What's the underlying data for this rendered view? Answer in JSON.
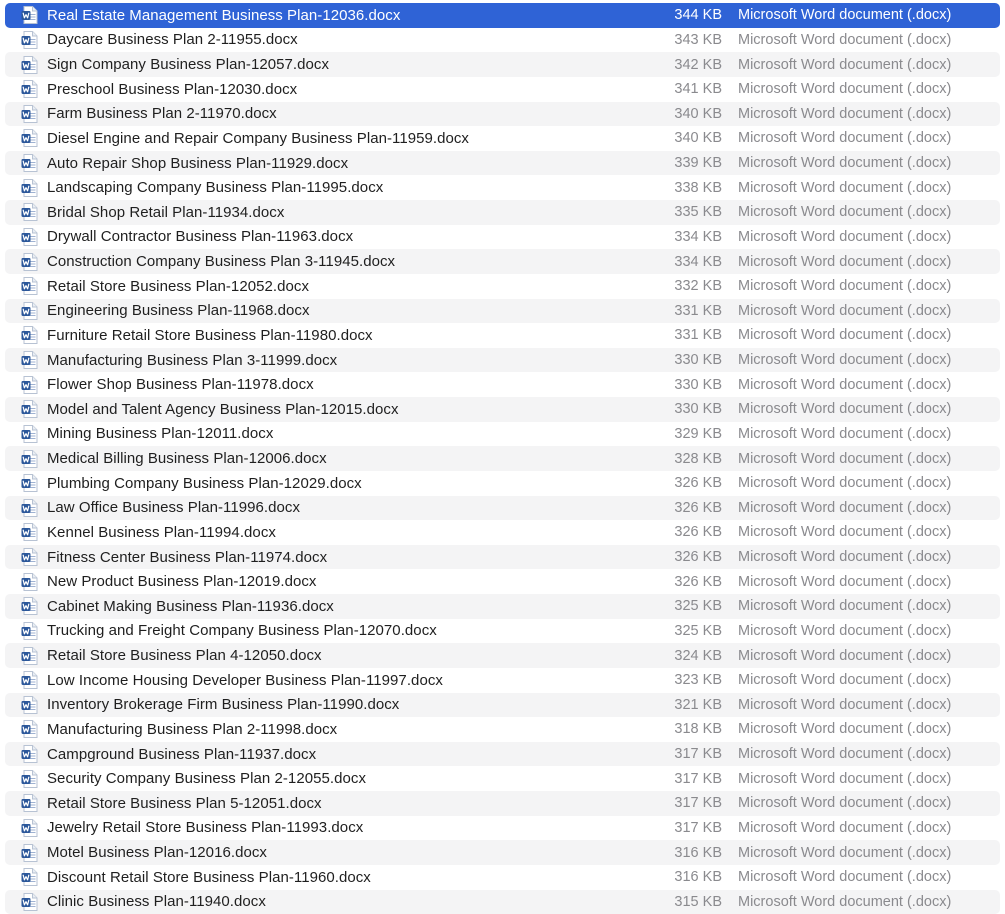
{
  "colors": {
    "selection": "#2f63d6",
    "stripe": "#f4f4f5",
    "word_blue": "#2b579a",
    "secondary_text": "#8a8a8e"
  },
  "icon_name": "word-document-icon",
  "selected_index": 0,
  "files": [
    {
      "name": "Real Estate Management Business Plan-12036.docx",
      "size": "344 KB",
      "kind": "Microsoft Word document (.docx)"
    },
    {
      "name": "Daycare Business Plan 2-11955.docx",
      "size": "343 KB",
      "kind": "Microsoft Word document (.docx)"
    },
    {
      "name": "Sign Company Business Plan-12057.docx",
      "size": "342 KB",
      "kind": "Microsoft Word document (.docx)"
    },
    {
      "name": "Preschool Business Plan-12030.docx",
      "size": "341 KB",
      "kind": "Microsoft Word document (.docx)"
    },
    {
      "name": "Farm Business Plan 2-11970.docx",
      "size": "340 KB",
      "kind": "Microsoft Word document (.docx)"
    },
    {
      "name": "Diesel Engine and Repair Company Business Plan-11959.docx",
      "size": "340 KB",
      "kind": "Microsoft Word document (.docx)"
    },
    {
      "name": "Auto Repair Shop Business Plan-11929.docx",
      "size": "339 KB",
      "kind": "Microsoft Word document (.docx)"
    },
    {
      "name": "Landscaping Company Business Plan-11995.docx",
      "size": "338 KB",
      "kind": "Microsoft Word document (.docx)"
    },
    {
      "name": "Bridal Shop Retail Plan-11934.docx",
      "size": "335 KB",
      "kind": "Microsoft Word document (.docx)"
    },
    {
      "name": "Drywall Contractor Business Plan-11963.docx",
      "size": "334 KB",
      "kind": "Microsoft Word document (.docx)"
    },
    {
      "name": "Construction Company Business Plan 3-11945.docx",
      "size": "334 KB",
      "kind": "Microsoft Word document (.docx)"
    },
    {
      "name": "Retail Store Business Plan-12052.docx",
      "size": "332 KB",
      "kind": "Microsoft Word document (.docx)"
    },
    {
      "name": "Engineering Business Plan-11968.docx",
      "size": "331 KB",
      "kind": "Microsoft Word document (.docx)"
    },
    {
      "name": "Furniture Retail Store Business Plan-11980.docx",
      "size": "331 KB",
      "kind": "Microsoft Word document (.docx)"
    },
    {
      "name": "Manufacturing Business Plan 3-11999.docx",
      "size": "330 KB",
      "kind": "Microsoft Word document (.docx)"
    },
    {
      "name": "Flower Shop Business Plan-11978.docx",
      "size": "330 KB",
      "kind": "Microsoft Word document (.docx)"
    },
    {
      "name": "Model and Talent Agency Business Plan-12015.docx",
      "size": "330 KB",
      "kind": "Microsoft Word document (.docx)"
    },
    {
      "name": "Mining Business Plan-12011.docx",
      "size": "329 KB",
      "kind": "Microsoft Word document (.docx)"
    },
    {
      "name": "Medical Billing Business Plan-12006.docx",
      "size": "328 KB",
      "kind": "Microsoft Word document (.docx)"
    },
    {
      "name": "Plumbing Company Business Plan-12029.docx",
      "size": "326 KB",
      "kind": "Microsoft Word document (.docx)"
    },
    {
      "name": "Law Office Business Plan-11996.docx",
      "size": "326 KB",
      "kind": "Microsoft Word document (.docx)"
    },
    {
      "name": "Kennel Business Plan-11994.docx",
      "size": "326 KB",
      "kind": "Microsoft Word document (.docx)"
    },
    {
      "name": "Fitness Center Business Plan-11974.docx",
      "size": "326 KB",
      "kind": "Microsoft Word document (.docx)"
    },
    {
      "name": "New Product Business Plan-12019.docx",
      "size": "326 KB",
      "kind": "Microsoft Word document (.docx)"
    },
    {
      "name": "Cabinet Making Business Plan-11936.docx",
      "size": "325 KB",
      "kind": "Microsoft Word document (.docx)"
    },
    {
      "name": "Trucking and Freight Company Business Plan-12070.docx",
      "size": "325 KB",
      "kind": "Microsoft Word document (.docx)"
    },
    {
      "name": "Retail Store Business Plan 4-12050.docx",
      "size": "324 KB",
      "kind": "Microsoft Word document (.docx)"
    },
    {
      "name": "Low Income Housing Developer Business Plan-11997.docx",
      "size": "323 KB",
      "kind": "Microsoft Word document (.docx)"
    },
    {
      "name": "Inventory Brokerage Firm Business Plan-11990.docx",
      "size": "321 KB",
      "kind": "Microsoft Word document (.docx)"
    },
    {
      "name": "Manufacturing Business Plan 2-11998.docx",
      "size": "318 KB",
      "kind": "Microsoft Word document (.docx)"
    },
    {
      "name": "Campground Business Plan-11937.docx",
      "size": "317 KB",
      "kind": "Microsoft Word document (.docx)"
    },
    {
      "name": "Security Company Business Plan 2-12055.docx",
      "size": "317 KB",
      "kind": "Microsoft Word document (.docx)"
    },
    {
      "name": "Retail Store Business Plan 5-12051.docx",
      "size": "317 KB",
      "kind": "Microsoft Word document (.docx)"
    },
    {
      "name": "Jewelry Retail Store Business Plan-11993.docx",
      "size": "317 KB",
      "kind": "Microsoft Word document (.docx)"
    },
    {
      "name": "Motel Business Plan-12016.docx",
      "size": "316 KB",
      "kind": "Microsoft Word document (.docx)"
    },
    {
      "name": "Discount Retail Store Business Plan-11960.docx",
      "size": "316 KB",
      "kind": "Microsoft Word document (.docx)"
    },
    {
      "name": "Clinic Business Plan-11940.docx",
      "size": "315 KB",
      "kind": "Microsoft Word document (.docx)"
    }
  ]
}
